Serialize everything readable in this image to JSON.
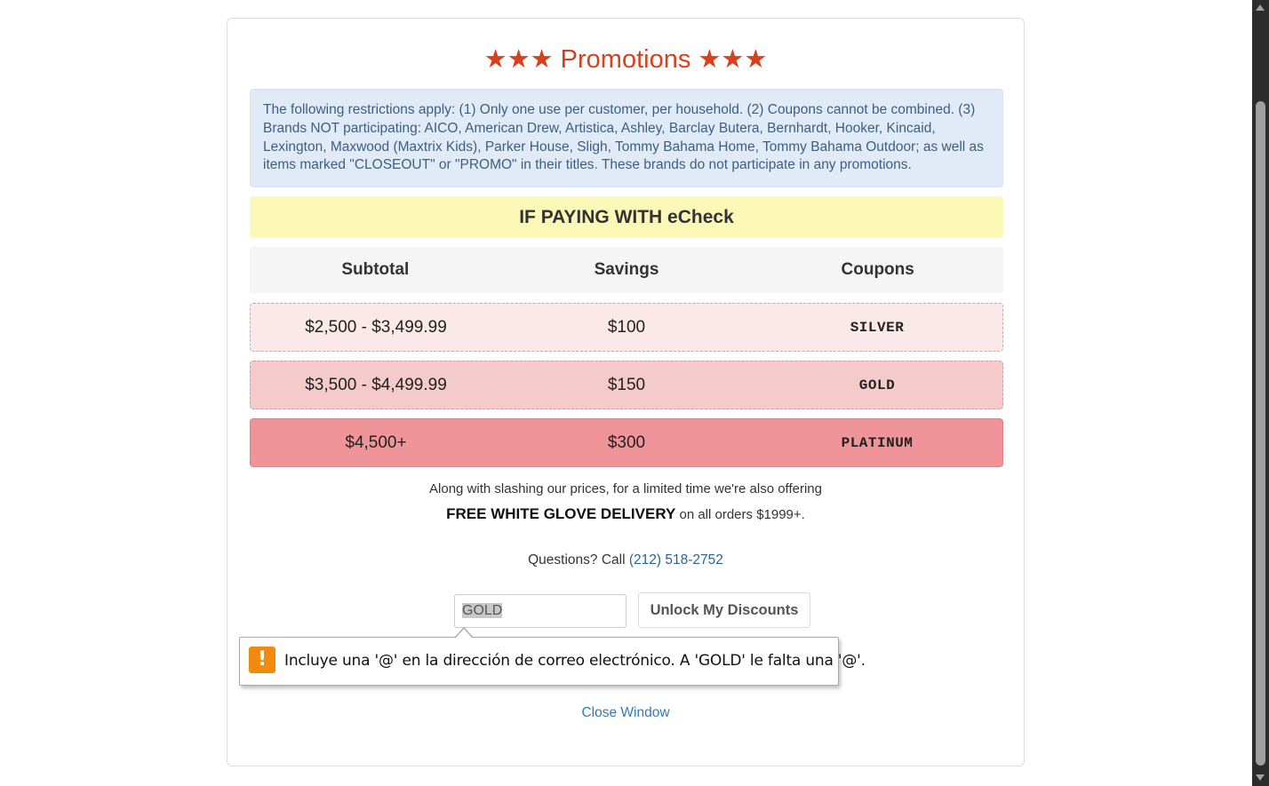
{
  "title": "★★★ Promotions ★★★",
  "notice": "The following restrictions apply: (1) Only one use per customer, per household. (2) Coupons cannot be combined. (3) Brands NOT participating: AICO, American Drew, Artistica, Ashley, Barclay Butera, Bernhardt, Hooker, Kincaid, Lexington, Maxwood (Maxtrix Kids), Parker House, Sligh, Tommy Bahama Home, Tommy Bahama Outdoor; as well as items marked \"CLOSEOUT\" or \"PROMO\" in their titles. These brands do not participate in any promotions.",
  "banner": "IF PAYING WITH eCheck",
  "table": {
    "headers": [
      "Subtotal",
      "Savings",
      "Coupons"
    ],
    "rows": [
      {
        "subtotal": "$2,500 - $3,499.99",
        "savings": "$100",
        "coupon": "SILVER"
      },
      {
        "subtotal": "$3,500 - $4,499.99",
        "savings": "$150",
        "coupon": "GOLD"
      },
      {
        "subtotal": "$4,500+",
        "savings": "$300",
        "coupon": "PLATINUM"
      }
    ]
  },
  "promo": {
    "line1": "Along with slashing our prices, for a limited time we're also offering",
    "bold": "FREE WHITE GLOVE DELIVERY",
    "line2_rest": " on all orders $1999+."
  },
  "questions": {
    "prefix": "Questions? Call ",
    "phone": "(212) 518-2752"
  },
  "form": {
    "input_value": "GOLD",
    "button_label": "Unlock My Discounts"
  },
  "validation_tooltip": {
    "icon": "!",
    "message": "Incluye una '@' en la dirección de correo electrónico. A 'GOLD' le falta una '@'."
  },
  "close_link": "Close Window",
  "colors": {
    "title": "#d8401e",
    "notice_bg": "#e1ebf7",
    "banner_bg": "#fcf8b8",
    "row_silver": "#fbe9e9",
    "row_gold": "#f5caca",
    "row_platinum": "#ef9599",
    "warning_icon": "#f08a10",
    "link": "#337ab7"
  }
}
